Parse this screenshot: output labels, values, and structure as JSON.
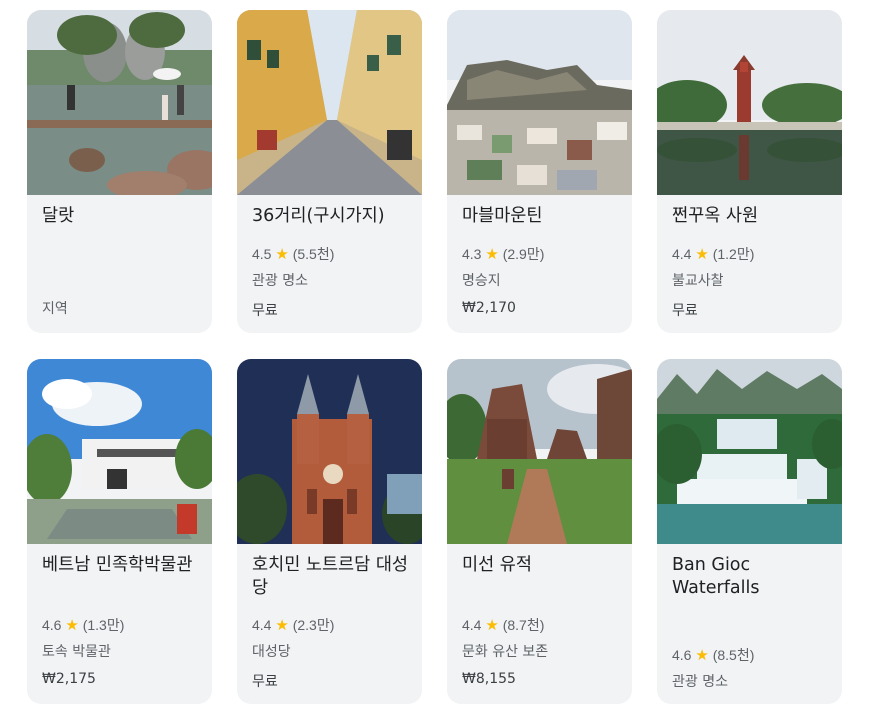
{
  "cards": [
    {
      "title": "달랏",
      "rating": "",
      "reviews": "",
      "category": "지역",
      "price": ""
    },
    {
      "title": "36거리(구시가지)",
      "rating": "4.5",
      "reviews": "(5.5천)",
      "category": "관광 명소",
      "price": "무료"
    },
    {
      "title": "마블마운틴",
      "rating": "4.3",
      "reviews": "(2.9만)",
      "category": "명승지",
      "price": "₩2,170"
    },
    {
      "title": "쩐꾸옥 사원",
      "rating": "4.4",
      "reviews": "(1.2만)",
      "category": "불교사찰",
      "price": "무료"
    },
    {
      "title": "베트남 민족학박물관",
      "rating": "4.6",
      "reviews": "(1.3만)",
      "category": "토속 박물관",
      "price": "₩2,175"
    },
    {
      "title": "호치민 노트르담 대성당",
      "rating": "4.4",
      "reviews": "(2.3만)",
      "category": "대성당",
      "price": "무료"
    },
    {
      "title": "미선 유적",
      "rating": "4.4",
      "reviews": "(8.7천)",
      "category": "문화 유산 보존",
      "price": "₩8,155"
    },
    {
      "title": "Ban Gioc Waterfalls",
      "rating": "4.6",
      "reviews": "(8.5천)",
      "category": "관광 명소",
      "price": ""
    }
  ],
  "colors": {
    "card_bg": "#f1f3f4",
    "star": "#fbbc04",
    "muted_text": "#5f6368"
  },
  "icons": {
    "rating": "star-icon"
  }
}
